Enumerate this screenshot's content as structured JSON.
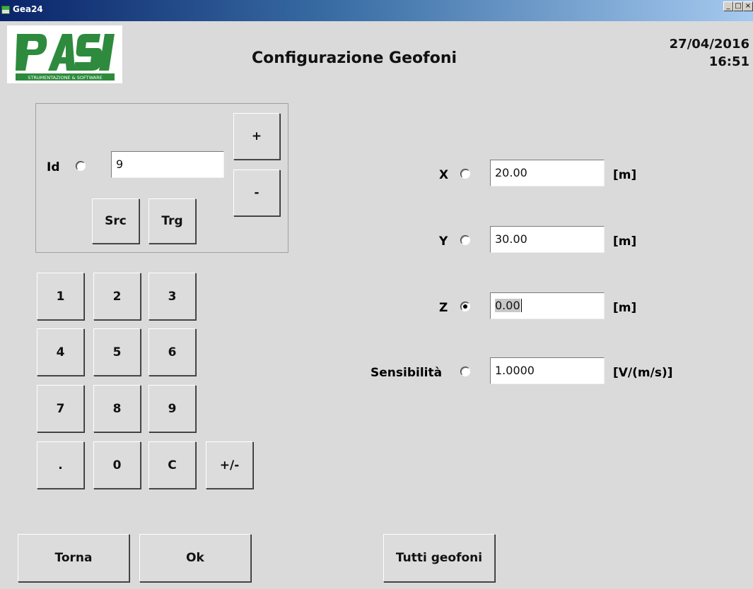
{
  "window": {
    "title": "Gea24",
    "controls": {
      "minimize": "_",
      "maximize": "□",
      "close": "×"
    }
  },
  "logo": {
    "text": "PASI",
    "tagline": "STRUMENTAZIONE & SOFTWARE",
    "color": "#2e8b3d"
  },
  "header": {
    "title": "Configurazione Geofoni",
    "date": "27/04/2016",
    "time": "16:51"
  },
  "id_group": {
    "label": "Id",
    "selected": false,
    "value": "9",
    "plus_label": "+",
    "minus_label": "-",
    "src_label": "Src",
    "trg_label": "Trg"
  },
  "keypad": [
    [
      "1",
      "2",
      "3"
    ],
    [
      "4",
      "5",
      "6"
    ],
    [
      "7",
      "8",
      "9"
    ],
    [
      ".",
      "0",
      "C",
      "+/-"
    ]
  ],
  "fields": [
    {
      "label": "X",
      "value": "20.00",
      "unit": "[m]",
      "selected": false
    },
    {
      "label": "Y",
      "value": "30.00",
      "unit": "[m]",
      "selected": false
    },
    {
      "label": "Z",
      "value": "0.00",
      "unit": "[m]",
      "selected": true
    },
    {
      "label": "Sensibilità",
      "value": "1.0000",
      "unit": "[V/(m/s)]",
      "selected": false
    }
  ],
  "footer": {
    "back_label": "Torna",
    "ok_label": "Ok",
    "all_label": "Tutti geofoni"
  }
}
